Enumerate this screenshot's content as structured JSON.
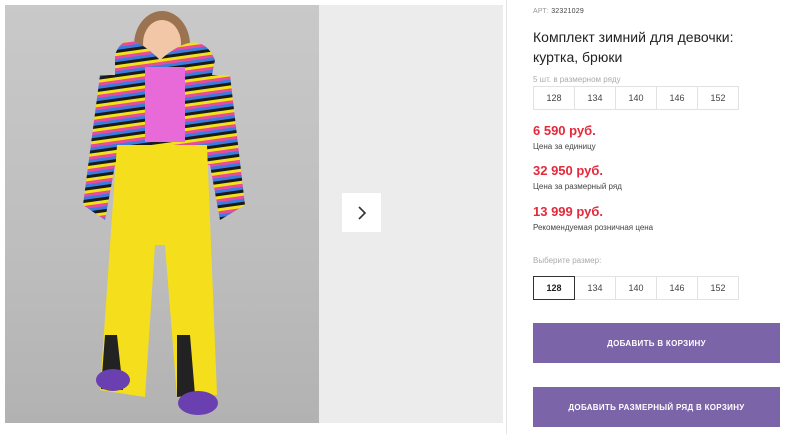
{
  "gallery": {
    "next_icon": "chevron-right-icon"
  },
  "product": {
    "article_label": "АРТ:",
    "article_number": "32321029",
    "title": "Комплект зимний для девочки: куртка, брюки",
    "pack_label": "5 шт. в размерном ряду",
    "pack_sizes": [
      "128",
      "134",
      "140",
      "146",
      "152"
    ],
    "price_unit": "6 590 руб.",
    "price_unit_caption": "Цена за единицу",
    "price_pack": "32 950 руб.",
    "price_pack_caption": "Цена за размерный ряд",
    "price_retail": "13 999 руб.",
    "price_retail_caption": "Рекомендуемая розничная цена",
    "choose_size_label": "Выберите размер:",
    "select_sizes": [
      "128",
      "134",
      "140",
      "146",
      "152"
    ],
    "selected_size": "128"
  },
  "actions": {
    "add_to_cart": "ДОБАВИТЬ В КОРЗИНУ",
    "add_pack_to_cart": "ДОБАВИТЬ РАЗМЕРНЫЙ РЯД В КОРЗИНУ"
  },
  "colors": {
    "price": "#e5283a",
    "button": "#7b64a8"
  }
}
